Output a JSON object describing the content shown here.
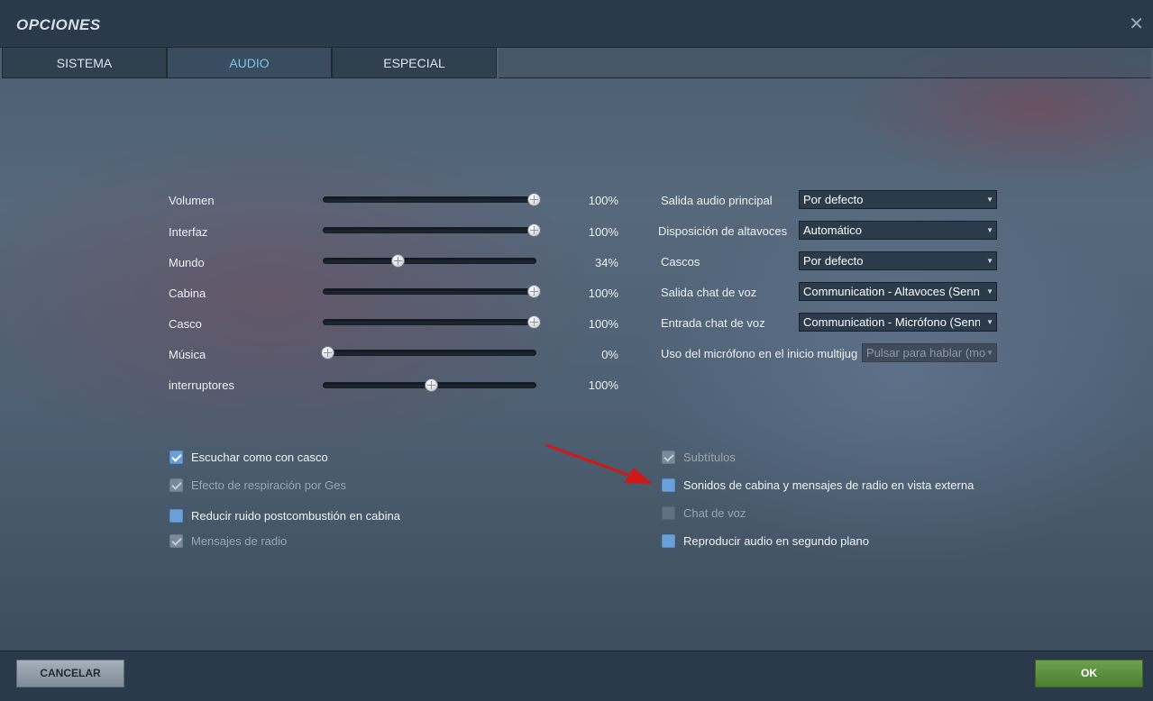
{
  "window": {
    "title": "OPCIONES",
    "close": "✕"
  },
  "tabs": [
    {
      "label": "SISTEMA",
      "active": false
    },
    {
      "label": "AUDIO",
      "active": true
    },
    {
      "label": "ESPECIAL",
      "active": false
    }
  ],
  "sliders": [
    {
      "label": "Volumen",
      "value": 100,
      "display": "100%"
    },
    {
      "label": "Interfaz",
      "value": 100,
      "display": "100%"
    },
    {
      "label": "Mundo",
      "value": 34,
      "display": "34%"
    },
    {
      "label": "Cabina",
      "value": 100,
      "display": "100%"
    },
    {
      "label": "Casco",
      "value": 100,
      "display": "100%"
    },
    {
      "label": "Música",
      "value": 0,
      "display": "0%"
    },
    {
      "label": "interruptores",
      "value": 50,
      "display": "100%"
    }
  ],
  "devices": [
    {
      "label": "Salida audio principal",
      "value": "Por defecto",
      "disabled": false
    },
    {
      "label": "Disposición de altavoces",
      "value": "Automático",
      "disabled": false
    },
    {
      "label": "Cascos",
      "value": "Por defecto",
      "disabled": false
    },
    {
      "label": "Salida chat de voz",
      "value": "Communication - Altavoces (Sennh",
      "disabled": false
    },
    {
      "label": "Entrada chat de voz",
      "value": "Communication - Micrófono (Sennh",
      "disabled": false
    },
    {
      "label": "Uso del micrófono en el inicio multijug",
      "value": "Pulsar para hablar (mo",
      "disabled": true
    }
  ],
  "checkboxes_left": [
    {
      "label": "Escuchar como con casco",
      "state": "checked"
    },
    {
      "label": "Efecto de respiración por Ges",
      "state": "dis-checked"
    },
    {
      "label": "Reducir ruido postcombustión en cabina",
      "state": "unchecked"
    },
    {
      "label": "Mensajes de radio",
      "state": "dis-checked"
    }
  ],
  "checkboxes_right": [
    {
      "label": "Subtítulos",
      "state": "dis-checked"
    },
    {
      "label": "Sonidos de cabina y mensajes de radio en vista externa",
      "state": "unchecked"
    },
    {
      "label": "Chat de voz",
      "state": "dis-unchecked"
    },
    {
      "label": "Reproducir audio en segundo plano",
      "state": "unchecked"
    }
  ],
  "footer": {
    "cancel": "CANCELAR",
    "ok": "OK"
  },
  "colors": {
    "accent_tab": "#7fc2ea",
    "ok_button": "#5a8f3f",
    "checkbox": "#6b9fd8",
    "annotation_arrow": "#d01818"
  }
}
